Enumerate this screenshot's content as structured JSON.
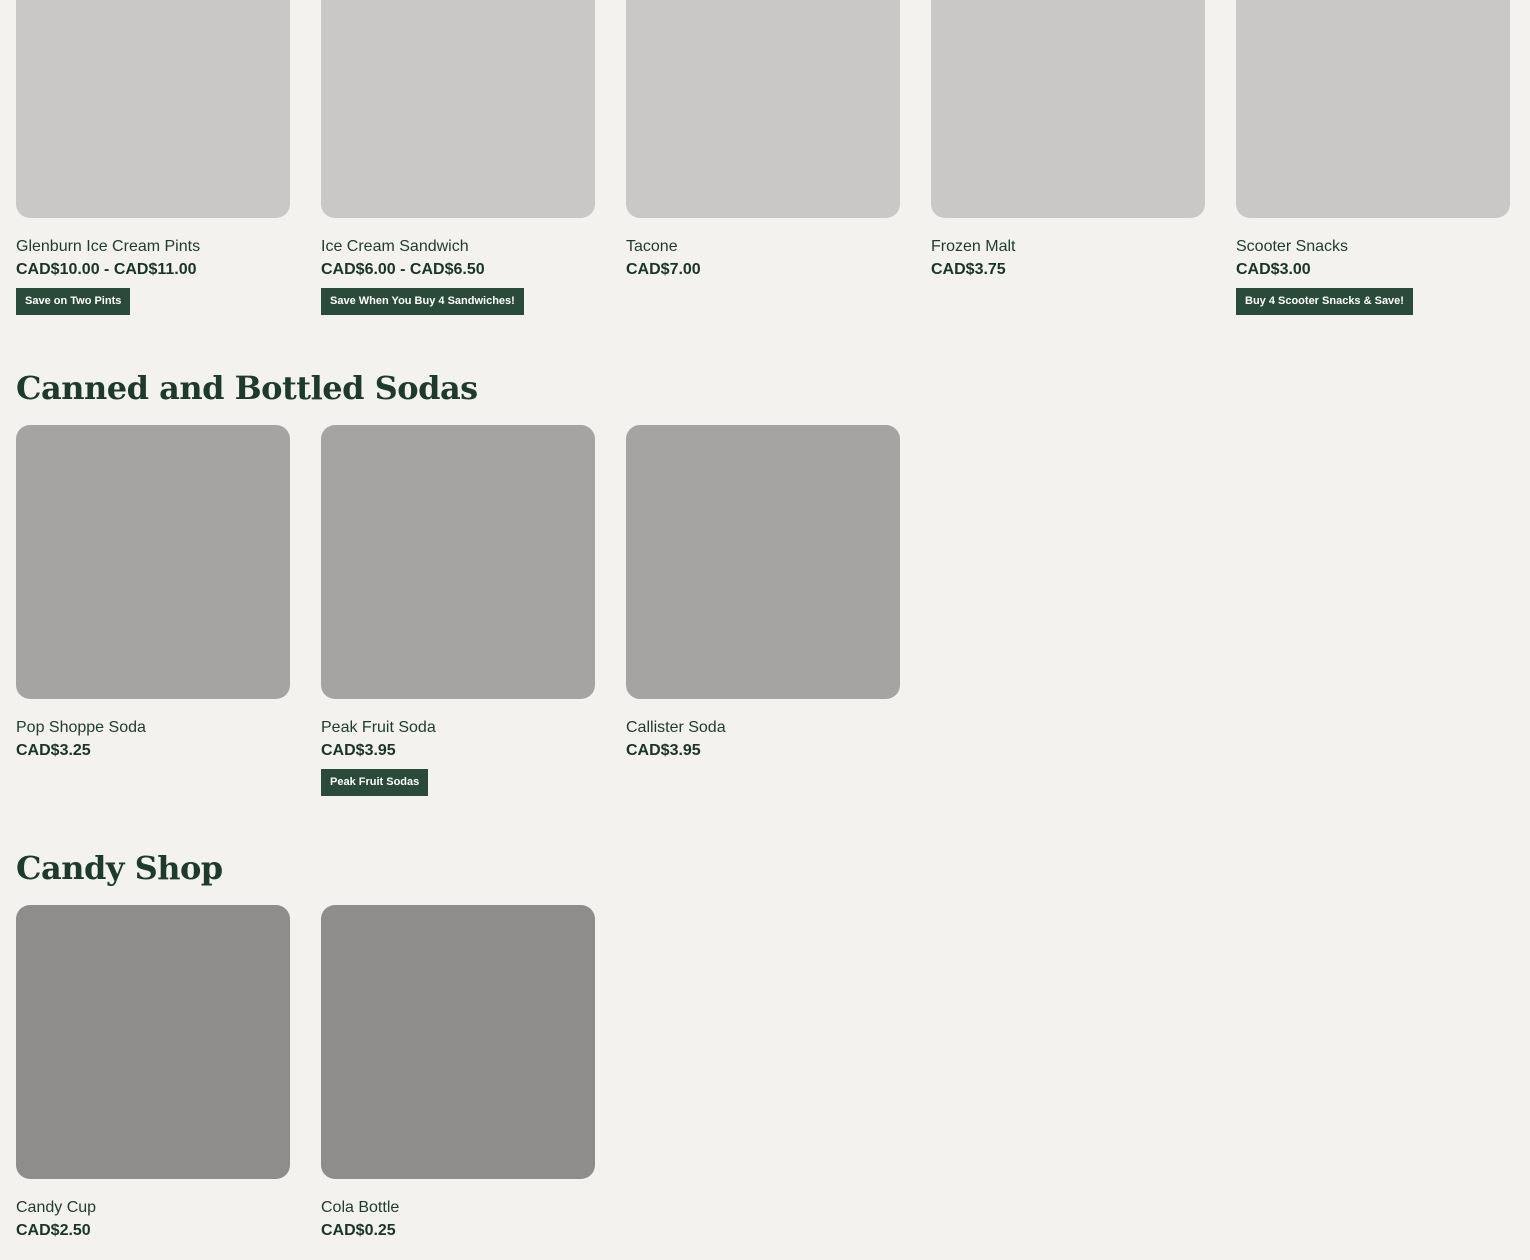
{
  "sections": [
    {
      "title": "",
      "items": [
        {
          "name": "Glenburn Ice Cream Pints",
          "price": "CAD$10.00 - CAD$11.00",
          "badge": "Save on Two Pints"
        },
        {
          "name": "Ice Cream Sandwich",
          "price": "CAD$6.00 - CAD$6.50",
          "badge": "Save When You Buy 4 Sandwiches!"
        },
        {
          "name": "Tacone",
          "price": "CAD$7.00",
          "badge": ""
        },
        {
          "name": "Frozen Malt",
          "price": "CAD$3.75",
          "badge": ""
        },
        {
          "name": "Scooter Snacks",
          "price": "CAD$3.00",
          "badge": "Buy 4 Scooter Snacks & Save!"
        }
      ]
    },
    {
      "title": "Canned and Bottled Sodas",
      "items": [
        {
          "name": "Pop Shoppe Soda",
          "price": "CAD$3.25",
          "badge": ""
        },
        {
          "name": "Peak Fruit Soda",
          "price": "CAD$3.95",
          "badge": "Peak Fruit Sodas"
        },
        {
          "name": "Callister Soda",
          "price": "CAD$3.95",
          "badge": ""
        }
      ]
    },
    {
      "title": "Candy Shop",
      "items": [
        {
          "name": "Candy Cup",
          "price": "CAD$2.50",
          "badge": ""
        },
        {
          "name": "Cola Bottle",
          "price": "CAD$0.25",
          "badge": ""
        }
      ]
    }
  ],
  "colors": {
    "background": "#f3f2ee",
    "text": "#1e3a2e",
    "badge": "#2a4a3a"
  }
}
